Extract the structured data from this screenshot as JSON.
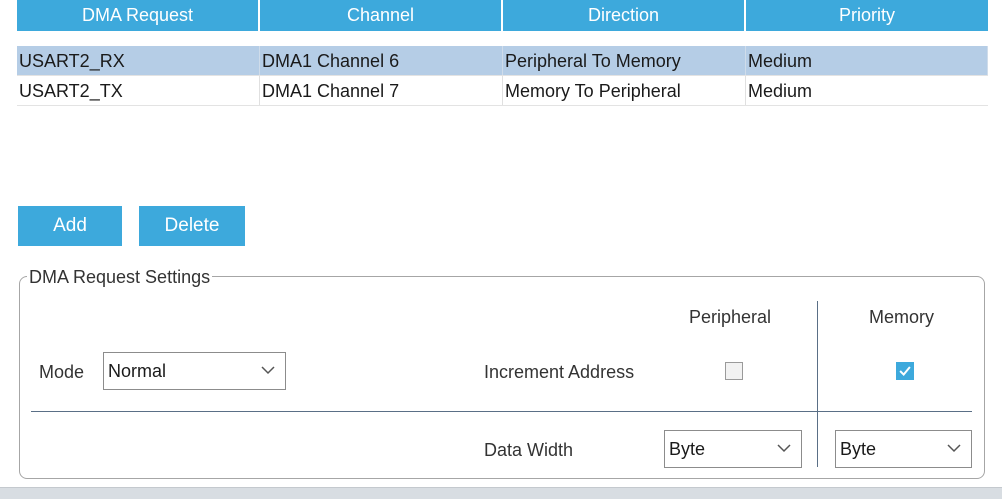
{
  "table": {
    "headers": [
      "DMA Request",
      "Channel",
      "Direction",
      "Priority"
    ],
    "rows": [
      {
        "request": "USART2_RX",
        "channel": "DMA1 Channel 6",
        "direction": "Peripheral To Memory",
        "priority": "Medium",
        "selected": true
      },
      {
        "request": "USART2_TX",
        "channel": "DMA1 Channel 7",
        "direction": "Memory To Peripheral",
        "priority": "Medium",
        "selected": false
      }
    ]
  },
  "buttons": {
    "add": "Add",
    "delete": "Delete"
  },
  "settings": {
    "legend": "DMA Request Settings",
    "peripheral_header": "Peripheral",
    "memory_header": "Memory",
    "mode_label": "Mode",
    "mode_value": "Normal",
    "increment_label": "Increment Address",
    "peripheral_increment": false,
    "memory_increment": true,
    "data_width_label": "Data Width",
    "peripheral_width": "Byte",
    "memory_width": "Byte"
  },
  "icons": {
    "dropdown": "chevron-down-icon",
    "check": "check-icon"
  },
  "colors": {
    "accent": "#3da9dc",
    "selected_row": "#b5cde6"
  }
}
